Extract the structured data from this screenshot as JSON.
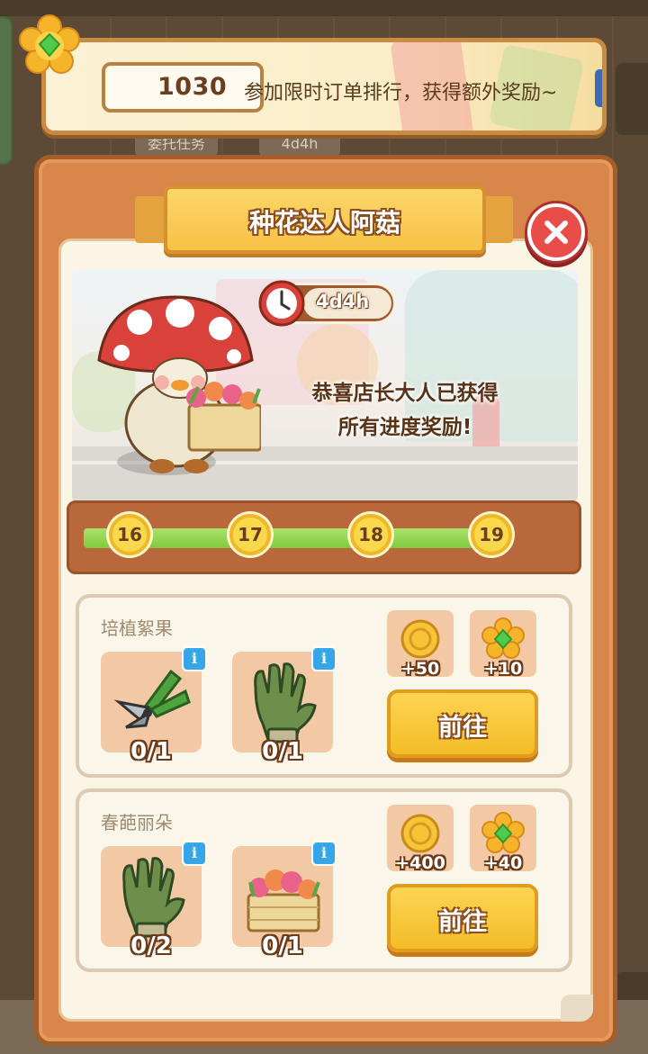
{
  "header": {
    "currency_value": "1030",
    "banner_text": "参加限时订单排行，获得额外奖励~"
  },
  "panel": {
    "title": "种花达人阿菇",
    "timer": "4d4h",
    "message_line1": "恭喜店长大人已获得",
    "message_line2": "所有进度奖励!"
  },
  "progress": {
    "milestones": [
      "16",
      "17",
      "18",
      "19"
    ],
    "fill_fraction": 0.98
  },
  "tasks": [
    {
      "title": "培植絮果",
      "items": [
        {
          "icon": "pruning-shears-icon",
          "count": "0/1"
        },
        {
          "icon": "gardening-glove-icon",
          "count": "0/1"
        }
      ],
      "rewards": [
        {
          "icon": "gold-coin-icon",
          "amount": "+50"
        },
        {
          "icon": "flower-gem-icon",
          "amount": "+10"
        }
      ],
      "button_label": "前往"
    },
    {
      "title": "春葩丽朵",
      "items": [
        {
          "icon": "gardening-glove-icon",
          "count": "0/2"
        },
        {
          "icon": "flower-crate-icon",
          "count": "0/1"
        }
      ],
      "rewards": [
        {
          "icon": "gold-coin-icon",
          "amount": "+400"
        },
        {
          "icon": "flower-gem-icon",
          "amount": "+40"
        }
      ],
      "button_label": "前往"
    }
  ],
  "colors": {
    "panel_orange": "#d9864a",
    "ribbon_yellow": "#f7c246",
    "progress_green": "#7fca3c",
    "close_red": "#e94d4a"
  }
}
